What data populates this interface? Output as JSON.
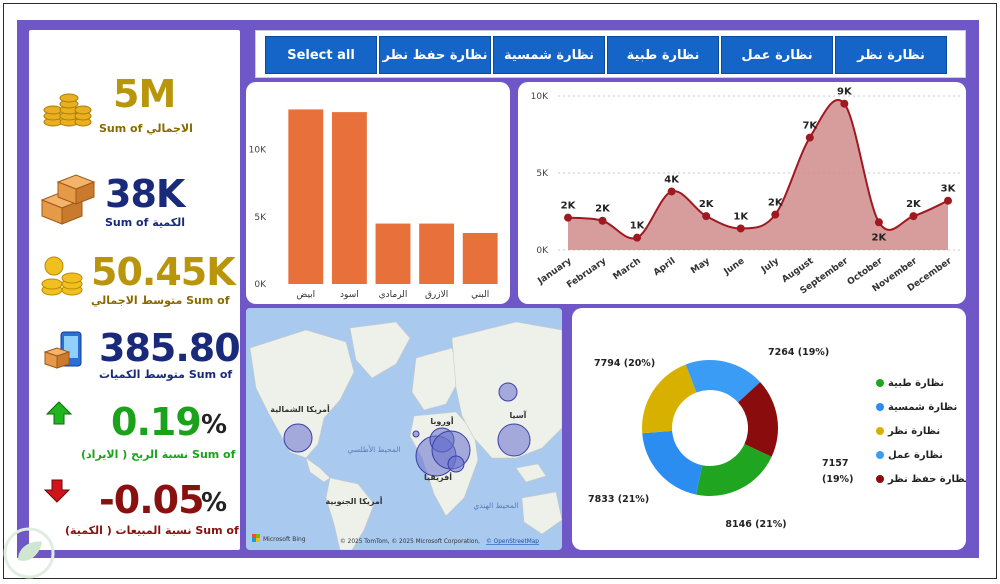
{
  "kpis": [
    {
      "value": "5M",
      "label": "Sum of الاجمالي",
      "color": "#b8950a",
      "icon": "gold-coins-stack-icon"
    },
    {
      "value": "38K",
      "label": "Sum of الكمية",
      "color": "#1a2a7a",
      "icon": "boxes-icon"
    },
    {
      "value": "50.45K",
      "label": "متوسط الاجمالي Sum of",
      "color": "#b8950a",
      "icon": "coins-icon"
    },
    {
      "value": "385.80",
      "label": "متوسط الكميات Sum of",
      "color": "#1a2a7a",
      "icon": "phone-boxes-icon"
    },
    {
      "value": "0.19",
      "pct": "%",
      "label": "نسبة الربح ( الايراد) Sum of",
      "color": "#1aa31a",
      "label_color": "#1aa31a",
      "icon": "arrow-up-icon"
    },
    {
      "value": "-0.05",
      "pct": "%",
      "label": "نسبة المبيعات ( الكمية) Sum of",
      "color": "#8a1010",
      "label_color": "#8a1010",
      "icon": "arrow-down-icon"
    }
  ],
  "slicer": {
    "buttons": [
      "Select all",
      "نظارة حفظ نظر",
      "نظارة شمسية",
      "نظارة طبية",
      "نظارة عمل",
      "نظارة نظر"
    ]
  },
  "map": {
    "labels": {
      "north_america": "أمريكا الشمالية",
      "south_america": "أمريكا الجنوبية",
      "europe": "أوروبا",
      "asia": "آسيا",
      "africa": "أفريقيا",
      "atlantic": "المحيط الأطلسي",
      "indian": "المحيط الهندي"
    },
    "logo": "Microsoft Bing",
    "attribution": "© 2025 TomTom, © 2025 Microsoft Corporation,",
    "attribution_link": "© OpenStreetMap"
  },
  "colors": {
    "bar": "#e8703a",
    "line": "#a01820",
    "area": "#d08c8c",
    "background": "#7057c8",
    "slicer": "#1565c8"
  },
  "chart_data": [
    {
      "type": "bar",
      "categories": [
        "ابيض",
        "اسود",
        "الرمادي",
        "الازرق",
        "البني"
      ],
      "values": [
        13000,
        12800,
        4500,
        4500,
        3800
      ],
      "ylim": [
        0,
        14000
      ],
      "yticks": [
        "0K",
        "5K",
        "10K"
      ],
      "ytick_values": [
        0,
        5000,
        10000
      ]
    },
    {
      "type": "line",
      "categories": [
        "January",
        "February",
        "March",
        "April",
        "May",
        "June",
        "July",
        "August",
        "September",
        "October",
        "November",
        "December"
      ],
      "values": [
        2100,
        1900,
        800,
        3800,
        2200,
        1400,
        2300,
        7300,
        9500,
        1800,
        2200,
        3200
      ],
      "data_labels": [
        "2K",
        "2K",
        "1K",
        "4K",
        "2K",
        "1K",
        "2K",
        "7K",
        "9K",
        "2K",
        "2K",
        "3K"
      ],
      "ylim": [
        0,
        10000
      ],
      "yticks": [
        "0K",
        "5K",
        "10K"
      ],
      "ytick_values": [
        0,
        5000,
        10000
      ]
    },
    {
      "type": "pie",
      "donut": true,
      "series": [
        {
          "name": "نظارة طبية",
          "value": 8146,
          "label": "8146 (21%)",
          "color": "#1fa51f"
        },
        {
          "name": "نظارة شمسية",
          "value": 7833,
          "label": "7833 (21%)",
          "color": "#2b8df0"
        },
        {
          "name": "نظارة نظر",
          "value": 7794,
          "label": "7794 (20%)",
          "color": "#d8b100"
        },
        {
          "name": "نظارة عمل",
          "value": 7264,
          "label": "7264 (19%)",
          "color": "#3b9cf5"
        },
        {
          "name": "نظارة حفظ نظر",
          "value": 7157,
          "label": "7157 (19%)",
          "color": "#8b0c0c"
        }
      ]
    },
    {
      "type": "scatter",
      "bubbles": [
        {
          "region": "north-america",
          "size": 1
        },
        {
          "region": "west-africa",
          "size": 3
        },
        {
          "region": "europe-east",
          "size": 2
        },
        {
          "region": "middle-east",
          "size": 3
        },
        {
          "region": "india",
          "size": 1
        },
        {
          "region": "asia",
          "size": 2
        },
        {
          "region": "russia",
          "size": 1
        }
      ]
    }
  ]
}
